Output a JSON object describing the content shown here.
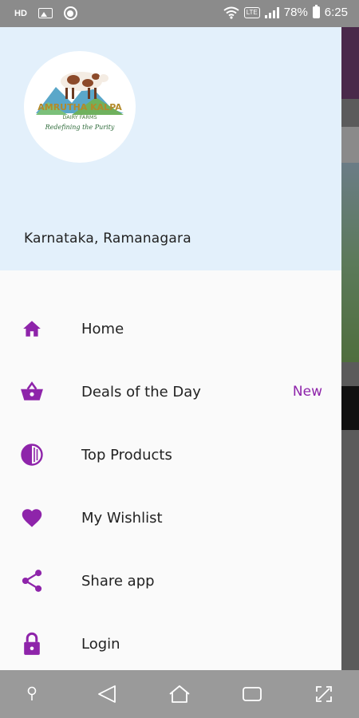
{
  "status_bar": {
    "hd_label": "HD",
    "battery_text": "78%",
    "time": "6:25",
    "volte_label": "LTE"
  },
  "drawer": {
    "logo": {
      "brand_line1": "AMRUTHA KALPA",
      "brand_line2": "DAIRY FARMS",
      "tagline": "Redefining the Purity"
    },
    "location": "Karnataka, Ramanagara",
    "accent_color": "#8e24aa",
    "header_bg": "#e3f0fb",
    "menu": [
      {
        "label": "Home",
        "icon": "home-icon"
      },
      {
        "label": "Deals of the Day",
        "icon": "basket-icon",
        "badge": "New"
      },
      {
        "label": "Top Products",
        "icon": "contrast-icon"
      },
      {
        "label": "My Wishlist",
        "icon": "heart-icon"
      },
      {
        "label": "Share app",
        "icon": "share-icon"
      },
      {
        "label": "Login",
        "icon": "lock-icon"
      }
    ]
  },
  "nav_bar": {
    "buttons": [
      "pin-icon",
      "back-icon",
      "home-icon",
      "recents-icon",
      "screenshot-icon"
    ]
  }
}
